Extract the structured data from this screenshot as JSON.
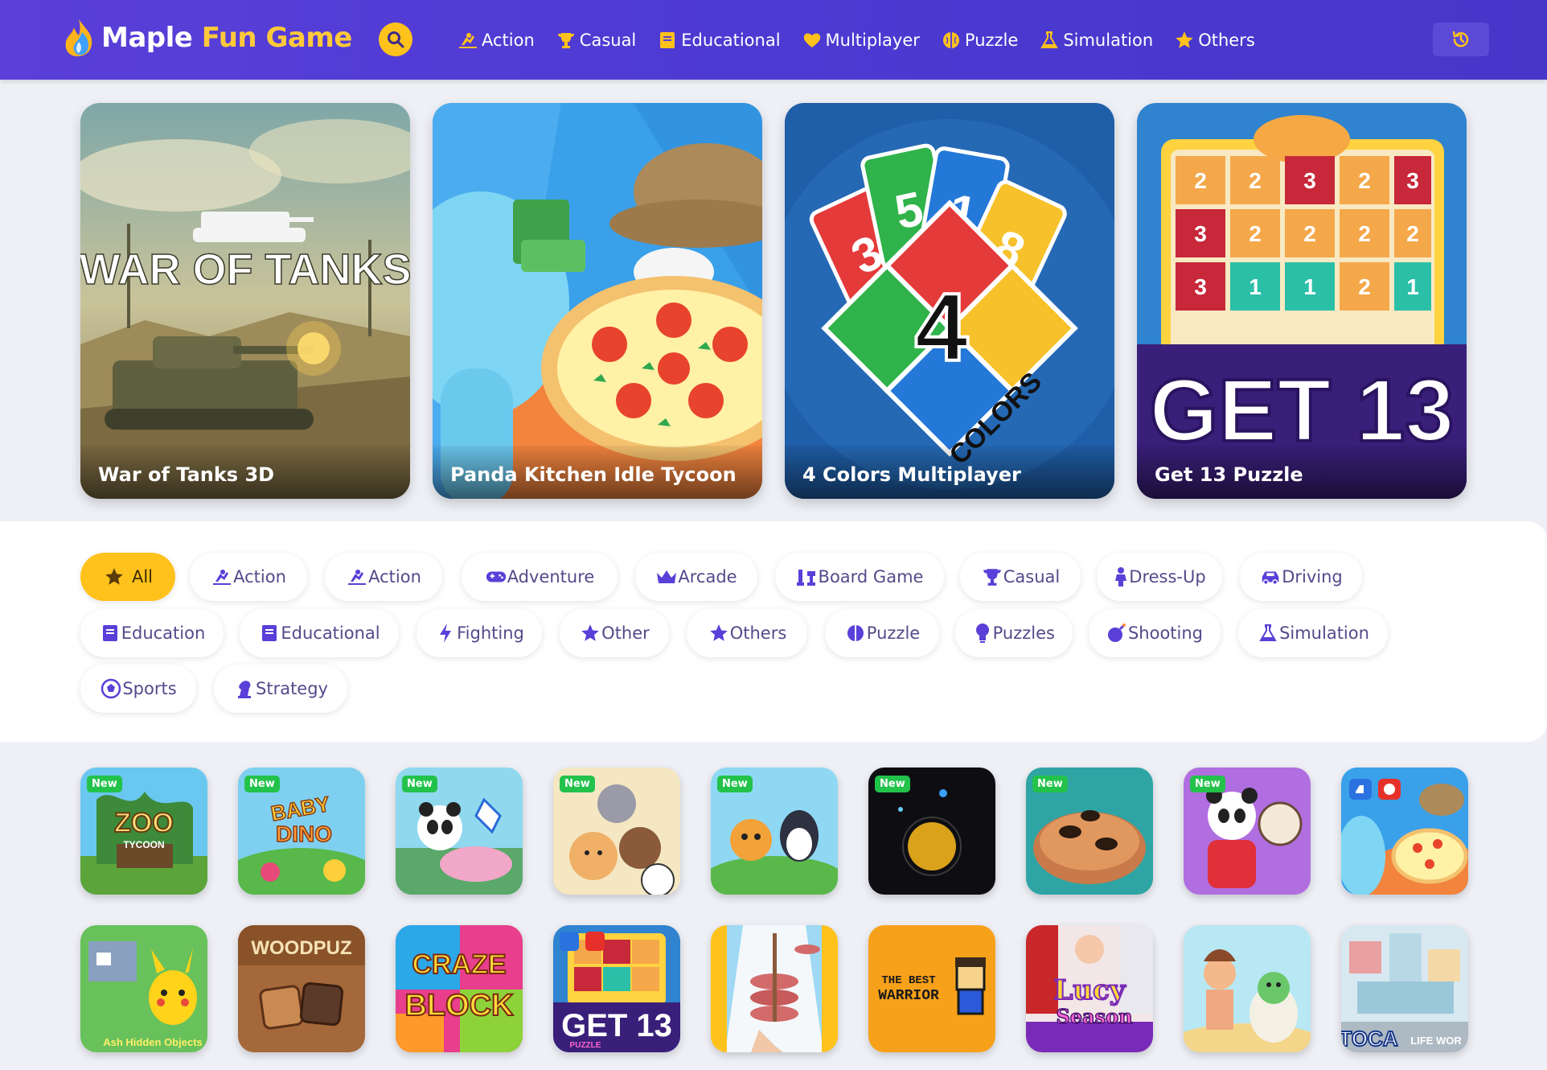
{
  "header": {
    "brand_part1": "Maple",
    "brand_part2": "Fun Game",
    "nav": [
      {
        "label": "Action",
        "icon": "action-icon"
      },
      {
        "label": "Casual",
        "icon": "trophy-icon"
      },
      {
        "label": "Educational",
        "icon": "book-icon"
      },
      {
        "label": "Multiplayer",
        "icon": "heart-icon"
      },
      {
        "label": "Puzzle",
        "icon": "brain-icon"
      },
      {
        "label": "Simulation",
        "icon": "flask-icon"
      },
      {
        "label": "Others",
        "icon": "star-icon"
      }
    ]
  },
  "featured": [
    {
      "title": "War of Tanks 3D",
      "art_text": "WAR OF TANKS"
    },
    {
      "title": "Panda Kitchen Idle Tycoon"
    },
    {
      "title": "4 Colors Multiplayer",
      "art_text": "4",
      "art_sub": "COLORS"
    },
    {
      "title": "Get 13 Puzzle",
      "art_text": "GET 13"
    }
  ],
  "categories": [
    {
      "label": "All",
      "icon": "star-icon",
      "active": true
    },
    {
      "label": "Action",
      "icon": "action-icon"
    },
    {
      "label": "Action",
      "icon": "action-icon"
    },
    {
      "label": "Adventure",
      "icon": "gamepad-icon"
    },
    {
      "label": "Arcade",
      "icon": "crown-icon"
    },
    {
      "label": "Board Game",
      "icon": "chess-icon"
    },
    {
      "label": "Casual",
      "icon": "trophy-icon"
    },
    {
      "label": "Dress-Up",
      "icon": "person-icon"
    },
    {
      "label": "Driving",
      "icon": "car-icon"
    },
    {
      "label": "Education",
      "icon": "book-icon"
    },
    {
      "label": "Educational",
      "icon": "book-icon"
    },
    {
      "label": "Fighting",
      "icon": "bolt-icon"
    },
    {
      "label": "Other",
      "icon": "star-icon"
    },
    {
      "label": "Others",
      "icon": "star-icon"
    },
    {
      "label": "Puzzle",
      "icon": "brain-icon"
    },
    {
      "label": "Puzzles",
      "icon": "bulb-icon"
    },
    {
      "label": "Shooting",
      "icon": "bomb-icon"
    },
    {
      "label": "Simulation",
      "icon": "flask-icon"
    },
    {
      "label": "Sports",
      "icon": "ball-icon"
    },
    {
      "label": "Strategy",
      "icon": "knight-icon"
    }
  ],
  "badge_new": "New",
  "grid": {
    "row1": [
      {
        "name": "zoo-tycoon",
        "new": true,
        "text": "ZOO",
        "text2": "TYCOON"
      },
      {
        "name": "baby-dino-planet",
        "new": true,
        "text": "BABY",
        "text2": "DINO"
      },
      {
        "name": "panda-game",
        "new": true
      },
      {
        "name": "animal-merge",
        "new": true
      },
      {
        "name": "cat-penguin",
        "new": true
      },
      {
        "name": "dark-orb",
        "new": true
      },
      {
        "name": "ants-game",
        "new": true
      },
      {
        "name": "panda-dumplings",
        "new": true
      },
      {
        "name": "panda-kitchen-small",
        "new": false
      }
    ],
    "row2": [
      {
        "name": "pikachu-hidden-objects",
        "text": "Ash Hidden Objects"
      },
      {
        "name": "woodpuz",
        "text": "WOODPUZ"
      },
      {
        "name": "craze-block",
        "text": "CRAZE",
        "text2": "BLOCK"
      },
      {
        "name": "get-13-small",
        "text": "GET 13",
        "text2": "PUZZLE"
      },
      {
        "name": "meat-stack"
      },
      {
        "name": "best-warrior",
        "text": "THE BEST",
        "text2": "WARRIOR"
      },
      {
        "name": "lucy-season",
        "text": "Lucy",
        "text2": "Season"
      },
      {
        "name": "dino-egg"
      },
      {
        "name": "toca-life-world",
        "text": "TOCA",
        "text2": "LIFE WOR"
      }
    ]
  }
}
